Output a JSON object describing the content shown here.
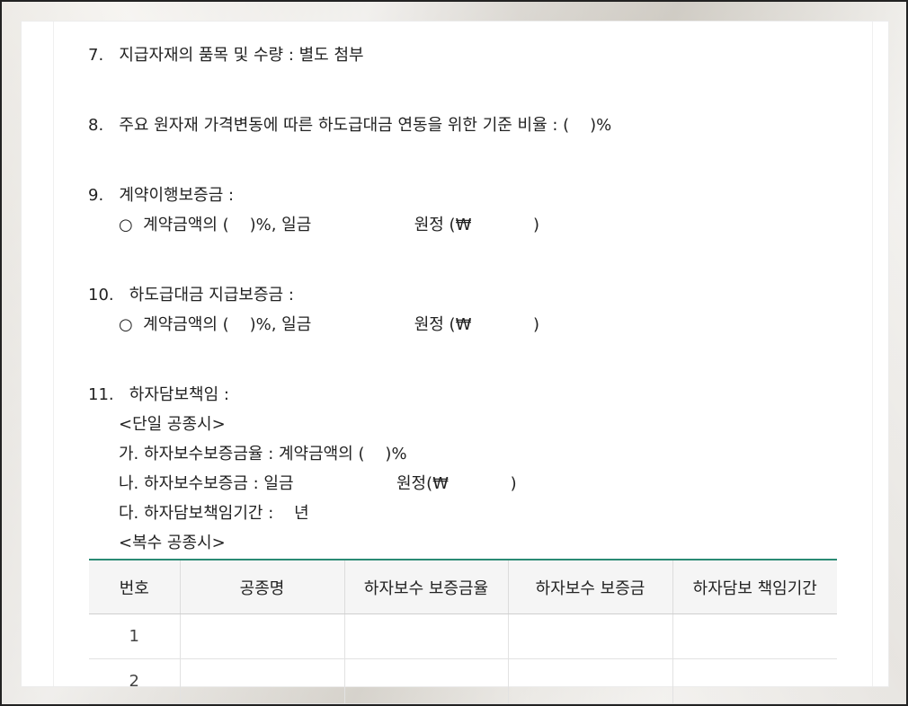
{
  "items": {
    "i7": "7.   지급자재의 품목 및 수량 : 별도 첨부",
    "i8": "8.   주요 원자재 가격변동에 따른 하도급대금 연동을 위한 기준 비율 : (    )%",
    "i9_title": "9.   계약이행보증금 :",
    "i9_sub": "○  계약금액의 (    )%, 일금                    원정 (₩            )",
    "i10_title": "10.   하도급대금 지급보증금 :",
    "i10_sub": "○  계약금액의 (    )%, 일금                    원정 (₩            )",
    "i11_title": "11.   하자담보책임 :",
    "i11_single": "<단일 공종시>",
    "i11_a": "가. 하자보수보증금율 : 계약금액의 (    )%",
    "i11_b": "나. 하자보수보증금 : 일금                    원정(₩            )",
    "i11_c": "다. 하자담보책임기간 :    년",
    "i11_multi": "<복수 공종시>"
  },
  "table": {
    "headers": [
      "번호",
      "공종명",
      "하자보수 보증금율",
      "하자보수 보증금",
      "하자담보 책임기간"
    ],
    "rows": [
      [
        "1",
        "",
        "",
        "",
        ""
      ],
      [
        "2",
        "",
        "",
        "",
        ""
      ]
    ]
  },
  "colors": {
    "accent": "#2a8a74",
    "header_bg": "#f5f5f5"
  }
}
